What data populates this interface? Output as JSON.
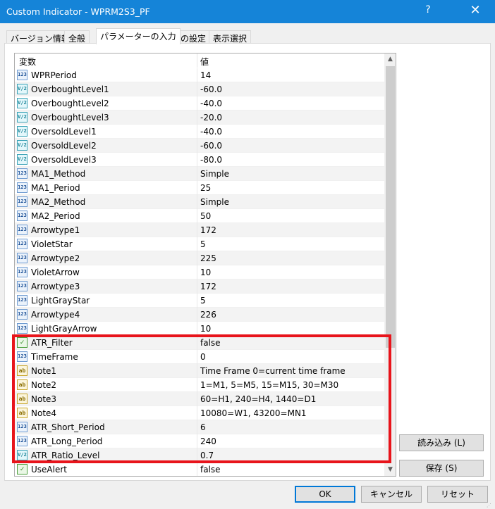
{
  "window": {
    "title": "Custom Indicator - WPRM2S3_PF",
    "help_label": "?",
    "close_label": "✕"
  },
  "tabs": [
    {
      "label": "バージョン情報"
    },
    {
      "label": "全般"
    },
    {
      "label": "パラメーターの入力"
    },
    {
      "label": "色の設定"
    },
    {
      "label": "表示選択"
    }
  ],
  "active_tab": "パラメーターの入力",
  "grid": {
    "col_variable": "変数",
    "col_value": "値",
    "rows": [
      {
        "icon": "123",
        "type": "int",
        "name": "WPRPeriod",
        "value": "14"
      },
      {
        "icon": "V/2",
        "type": "double",
        "name": "OverboughtLevel1",
        "value": "-60.0"
      },
      {
        "icon": "V/2",
        "type": "double",
        "name": "OverboughtLevel2",
        "value": "-40.0"
      },
      {
        "icon": "V/2",
        "type": "double",
        "name": "OverboughtLevel3",
        "value": "-20.0"
      },
      {
        "icon": "V/2",
        "type": "double",
        "name": "OversoldLevel1",
        "value": "-40.0"
      },
      {
        "icon": "V/2",
        "type": "double",
        "name": "OversoldLevel2",
        "value": "-60.0"
      },
      {
        "icon": "V/2",
        "type": "double",
        "name": "OversoldLevel3",
        "value": "-80.0"
      },
      {
        "icon": "123",
        "type": "enum",
        "name": "MA1_Method",
        "value": "Simple"
      },
      {
        "icon": "123",
        "type": "int",
        "name": "MA1_Period",
        "value": "25"
      },
      {
        "icon": "123",
        "type": "enum",
        "name": "MA2_Method",
        "value": "Simple"
      },
      {
        "icon": "123",
        "type": "int",
        "name": "MA2_Period",
        "value": "50"
      },
      {
        "icon": "123",
        "type": "int",
        "name": "Arrowtype1",
        "value": "172"
      },
      {
        "icon": "123",
        "type": "int",
        "name": "VioletStar",
        "value": "5"
      },
      {
        "icon": "123",
        "type": "int",
        "name": "Arrowtype2",
        "value": "225"
      },
      {
        "icon": "123",
        "type": "int",
        "name": "VioletArrow",
        "value": "10"
      },
      {
        "icon": "123",
        "type": "int",
        "name": "Arrowtype3",
        "value": "172"
      },
      {
        "icon": "123",
        "type": "int",
        "name": "LightGrayStar",
        "value": "5"
      },
      {
        "icon": "123",
        "type": "int",
        "name": "Arrowtype4",
        "value": "226"
      },
      {
        "icon": "123",
        "type": "int",
        "name": "LightGrayArrow",
        "value": "10"
      },
      {
        "icon": "✓",
        "type": "bool",
        "name": "ATR_Filter",
        "value": "false"
      },
      {
        "icon": "123",
        "type": "enum",
        "name": "TimeFrame",
        "value": "0"
      },
      {
        "icon": "ab",
        "type": "string",
        "name": "Note1",
        "value": "Time Frame 0=current time frame"
      },
      {
        "icon": "ab",
        "type": "string",
        "name": "Note2",
        "value": "1=M1, 5=M5, 15=M15, 30=M30"
      },
      {
        "icon": "ab",
        "type": "string",
        "name": "Note3",
        "value": "60=H1, 240=H4, 1440=D1"
      },
      {
        "icon": "ab",
        "type": "string",
        "name": "Note4",
        "value": "10080=W1, 43200=MN1"
      },
      {
        "icon": "123",
        "type": "int",
        "name": "ATR_Short_Period",
        "value": "6"
      },
      {
        "icon": "123",
        "type": "int",
        "name": "ATR_Long_Period",
        "value": "240"
      },
      {
        "icon": "V/2",
        "type": "double",
        "name": "ATR_Ratio_Level",
        "value": "0.7"
      },
      {
        "icon": "✓",
        "type": "bool",
        "name": "UseAlert",
        "value": "false"
      }
    ]
  },
  "side_buttons": {
    "load": "読み込み (L)",
    "save": "保存 (S)"
  },
  "footer_buttons": {
    "ok": "OK",
    "cancel": "キャンセル",
    "reset": "リセット"
  },
  "colors": {
    "titlebar": "#1584d8",
    "highlight": "#e8141b"
  }
}
